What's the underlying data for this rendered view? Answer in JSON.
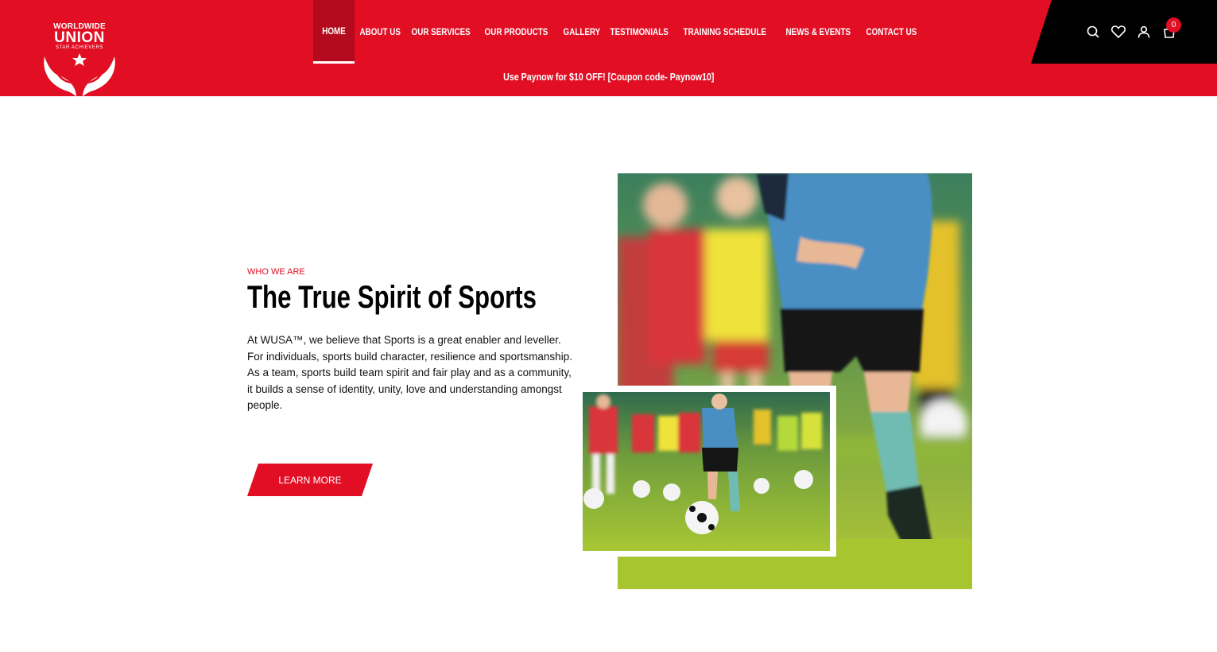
{
  "logo": {
    "line1": "WORLDWIDE",
    "line2": "UNION",
    "line3": "STAR ACHIEVERS"
  },
  "nav": {
    "items": [
      {
        "label": "HOME"
      },
      {
        "label": "ABOUT US"
      },
      {
        "label": "OUR SERVICES"
      },
      {
        "label": "OUR PRODUCTS"
      },
      {
        "label": "GALLERY"
      },
      {
        "label": "TESTIMONIALS"
      },
      {
        "label": "TRAINING SCHEDULE"
      },
      {
        "label": "NEWS & EVENTS"
      },
      {
        "label": "CONTACT US"
      }
    ],
    "active_index": 0
  },
  "promo": {
    "text": "Use Paynow for $10 OFF! [Coupon code- Paynow10]"
  },
  "header_icons": {
    "search": "search-icon",
    "wishlist": "heart-icon",
    "account": "user-icon",
    "cart": "cart-icon",
    "cart_count": "0"
  },
  "section": {
    "kicker": "WHO WE ARE",
    "title": "The True Spirit of Sports",
    "body": "At WUSA™, we believe that Sports is a great enabler and leveller. For individuals, sports build character, resilience and sportsmanship. As a team, sports build team spirit and fair play and as a community, it builds a sense of identity, unity, love and understanding amongst people.",
    "button_label": "LEARN MORE"
  },
  "colors": {
    "brand_red": "#e20e24",
    "dark_red": "#b30b1d",
    "black": "#000000",
    "grass": "#9cc22a"
  }
}
